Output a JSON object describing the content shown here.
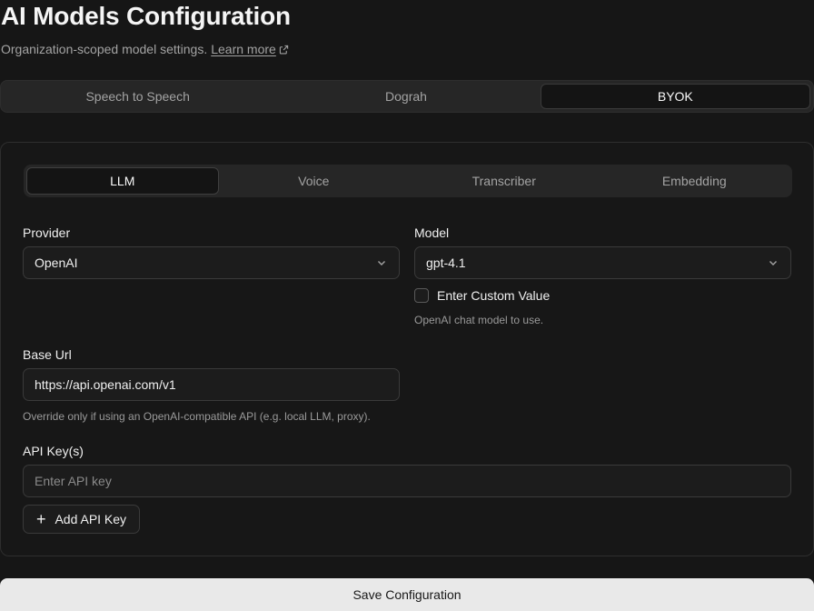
{
  "page": {
    "title": "AI Models Configuration",
    "subtitle": "Organization-scoped model settings.",
    "learn_more": "Learn more"
  },
  "top_tabs": [
    {
      "label": "Speech to Speech",
      "active": false
    },
    {
      "label": "Dograh",
      "active": false
    },
    {
      "label": "BYOK",
      "active": true
    }
  ],
  "sub_tabs": [
    {
      "label": "LLM",
      "active": true
    },
    {
      "label": "Voice",
      "active": false
    },
    {
      "label": "Transcriber",
      "active": false
    },
    {
      "label": "Embedding",
      "active": false
    }
  ],
  "form": {
    "provider_label": "Provider",
    "provider_value": "OpenAI",
    "model_label": "Model",
    "model_value": "gpt-4.1",
    "custom_value_label": "Enter Custom Value",
    "custom_value_checked": false,
    "model_help": "OpenAI chat model to use.",
    "base_url_label": "Base Url",
    "base_url_value": "https://api.openai.com/v1",
    "base_url_help": "Override only if using an OpenAI-compatible API (e.g. local LLM, proxy).",
    "api_key_label": "API Key(s)",
    "api_key_value": "",
    "api_key_placeholder": "Enter API key",
    "add_api_key_label": "Add API Key"
  },
  "actions": {
    "save_label": "Save Configuration"
  }
}
